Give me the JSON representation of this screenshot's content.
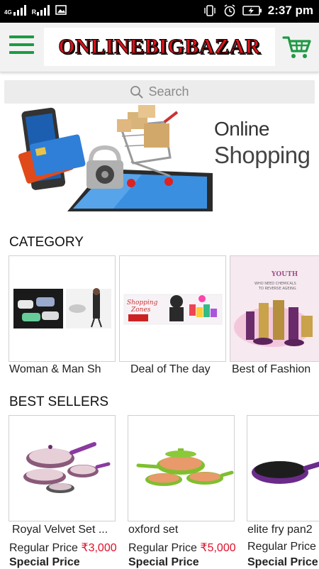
{
  "status_bar": {
    "network_left": "4G",
    "network_right": "R",
    "time": "2:37 pm"
  },
  "app_bar": {
    "logo_text": "ONLINEBIGBAZAR",
    "menu_icon": "hamburger-icon",
    "cart_icon": "cart-icon",
    "brand_color": "#1e9a44"
  },
  "search": {
    "placeholder": "Search",
    "icon": "search-icon"
  },
  "banner": {
    "line1": "Online",
    "line2": "Shopping"
  },
  "category": {
    "title": "CATEGORY",
    "items": [
      {
        "label": "Woman & Man Sh"
      },
      {
        "label": "Deal of The day"
      },
      {
        "label": "Best of Fashion"
      }
    ]
  },
  "best_sellers": {
    "title": "BEST SELLERS",
    "regular_label": "Regular Price",
    "special_label": "Special Price",
    "items": [
      {
        "name": "Royal Velvet Set ...",
        "price": "₹3,000"
      },
      {
        "name": "oxford set",
        "price": "₹5,000"
      },
      {
        "name": "elite fry pan2",
        "price": ""
      }
    ]
  }
}
